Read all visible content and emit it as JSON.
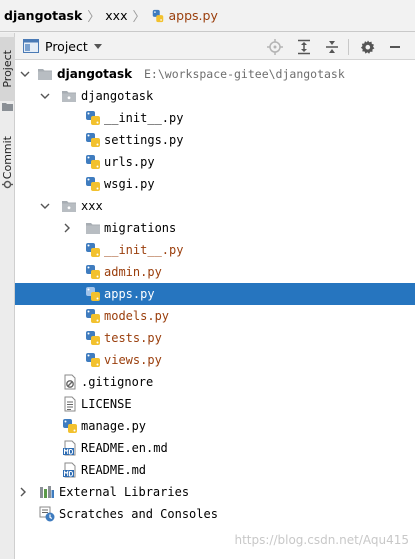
{
  "breadcrumb": {
    "root": "djangotask",
    "folder": "xxx",
    "file": "apps.py"
  },
  "sidebar_strip": {
    "tabs": [
      "Project",
      "Commit"
    ]
  },
  "panel": {
    "title": "Project",
    "tools": [
      "locate-icon",
      "expand-all-icon",
      "collapse-all-icon",
      "gear-icon",
      "hide-icon"
    ]
  },
  "tree": {
    "root": {
      "name": "djangotask",
      "path": "E:\\workspace-gitee\\djangotask"
    },
    "pkg_djangotask": {
      "name": "djangotask",
      "files": [
        "__init__.py",
        "settings.py",
        "urls.py",
        "wsgi.py"
      ]
    },
    "pkg_xxx": {
      "name": "xxx",
      "migrations": "migrations",
      "files": [
        "__init__.py",
        "admin.py",
        "apps.py",
        "models.py",
        "tests.py",
        "views.py"
      ]
    },
    "root_files": [
      ".gitignore",
      "LICENSE",
      "manage.py",
      "README.en.md",
      "README.md"
    ],
    "external_libraries": "External Libraries",
    "scratches": "Scratches and Consoles"
  },
  "colors": {
    "selection": "#2675bf",
    "modified_text": "#9a3e0c",
    "folder": "#a7adb3"
  },
  "watermark": "https://blog.csdn.net/Aqu415"
}
